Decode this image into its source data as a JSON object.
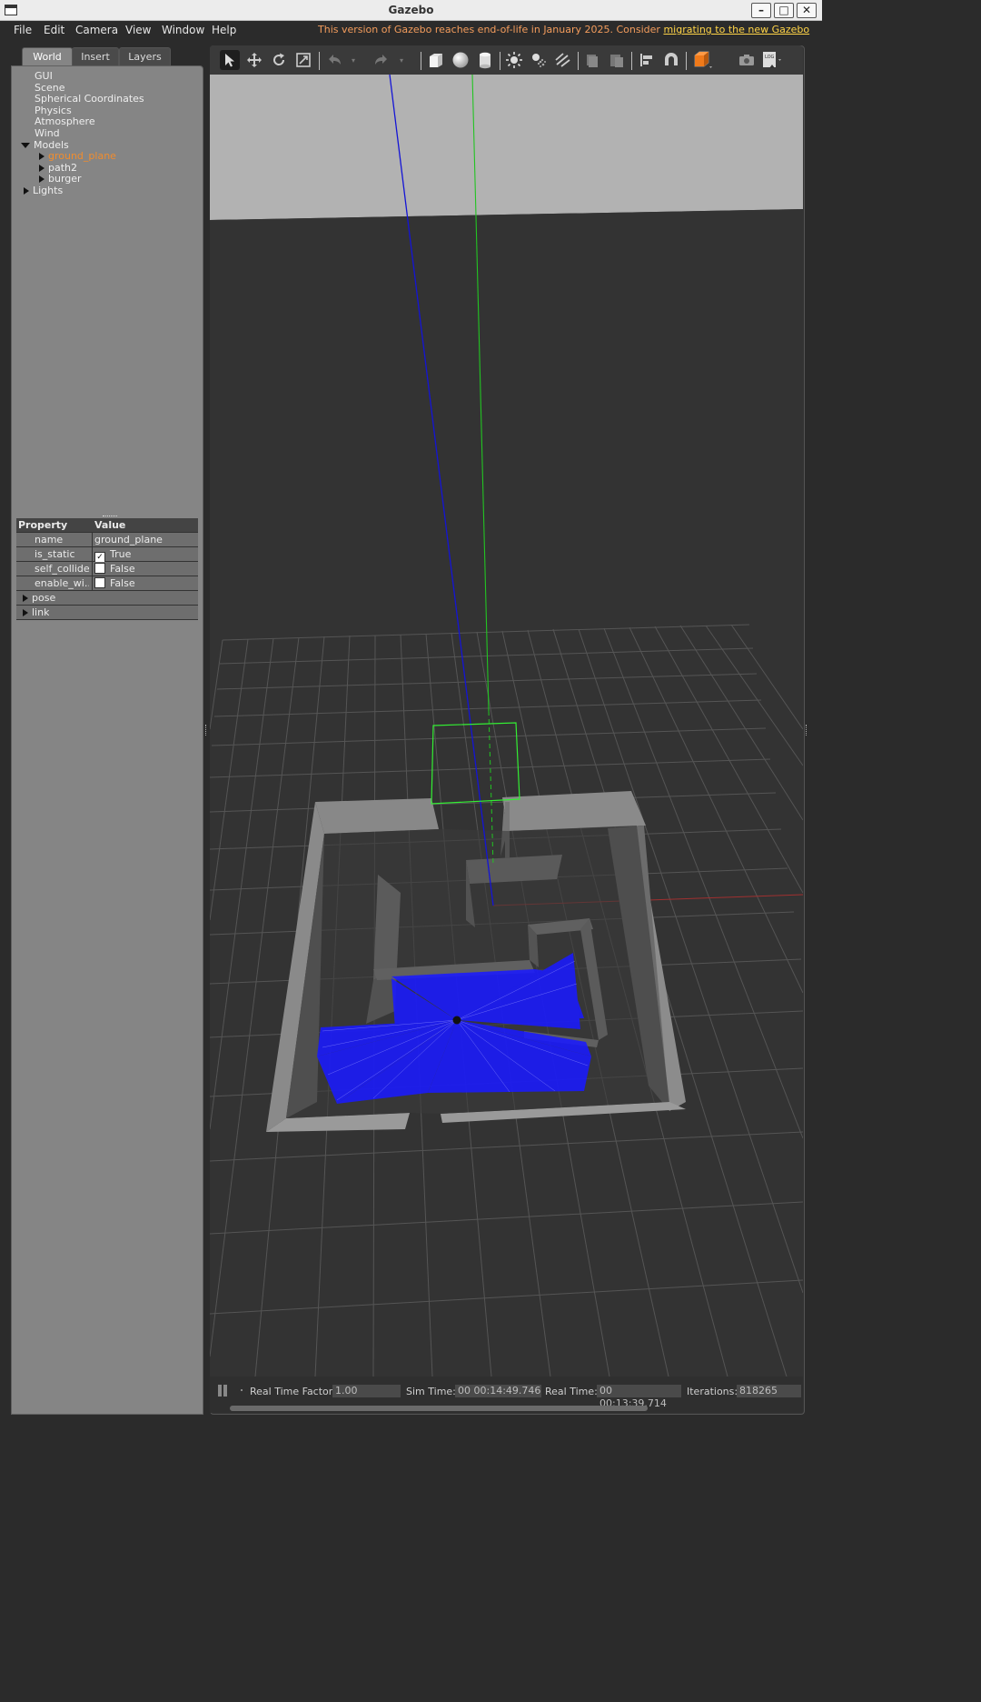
{
  "window": {
    "title": "Gazebo"
  },
  "menu": {
    "items": [
      "File",
      "Edit",
      "Camera",
      "View",
      "Window",
      "Help"
    ],
    "eol_notice": "This version of Gazebo reaches end-of-life in January 2025. Consider ",
    "eol_link": "migrating to the new Gazebo"
  },
  "tabs": [
    "World",
    "Insert",
    "Layers"
  ],
  "tree": {
    "items": [
      "GUI",
      "Scene",
      "Spherical Coordinates",
      "Physics",
      "Atmosphere",
      "Wind"
    ],
    "models_label": "Models",
    "models": [
      "ground_plane",
      "path2",
      "burger"
    ],
    "lights_label": "Lights",
    "selected": "ground_plane"
  },
  "properties": {
    "header_property": "Property",
    "header_value": "Value",
    "rows": [
      {
        "name": "name",
        "value": "ground_plane"
      },
      {
        "name": "is_static",
        "value": "True",
        "checked": true
      },
      {
        "name": "self_collide",
        "value": "False",
        "checked": false
      },
      {
        "name": "enable_wi...",
        "value": "False",
        "checked": false
      }
    ],
    "groups": [
      "pose",
      "link"
    ]
  },
  "toolbar": {
    "icons": [
      "select-mode-icon",
      "translate-icon",
      "rotate-icon",
      "scale-icon",
      "undo-icon",
      "redo-icon",
      "box-icon",
      "sphere-icon",
      "cylinder-icon",
      "point-light-icon",
      "spot-light-icon",
      "directional-light-icon",
      "copy-icon",
      "paste-icon",
      "align-icon",
      "snap-icon",
      "view-angle-icon",
      "screenshot-icon",
      "log-icon"
    ],
    "log_text": "LOG"
  },
  "status": {
    "rtf_label": "Real Time Factor:",
    "rtf_value": "1.00",
    "sim_time_label": "Sim Time:",
    "sim_time_value": "00 00:14:49.746",
    "real_time_label": "Real Time:",
    "real_time_value": "00 00:13:39.714",
    "iterations_label": "Iterations:",
    "iterations_value": "818265"
  },
  "colors": {
    "selected_item": "#f08c2e",
    "eol_text": "#f39c5c",
    "eol_link": "#ffd447",
    "laser": "#1a1aff",
    "sky": "#b2b2b2",
    "ground": "#333333"
  }
}
